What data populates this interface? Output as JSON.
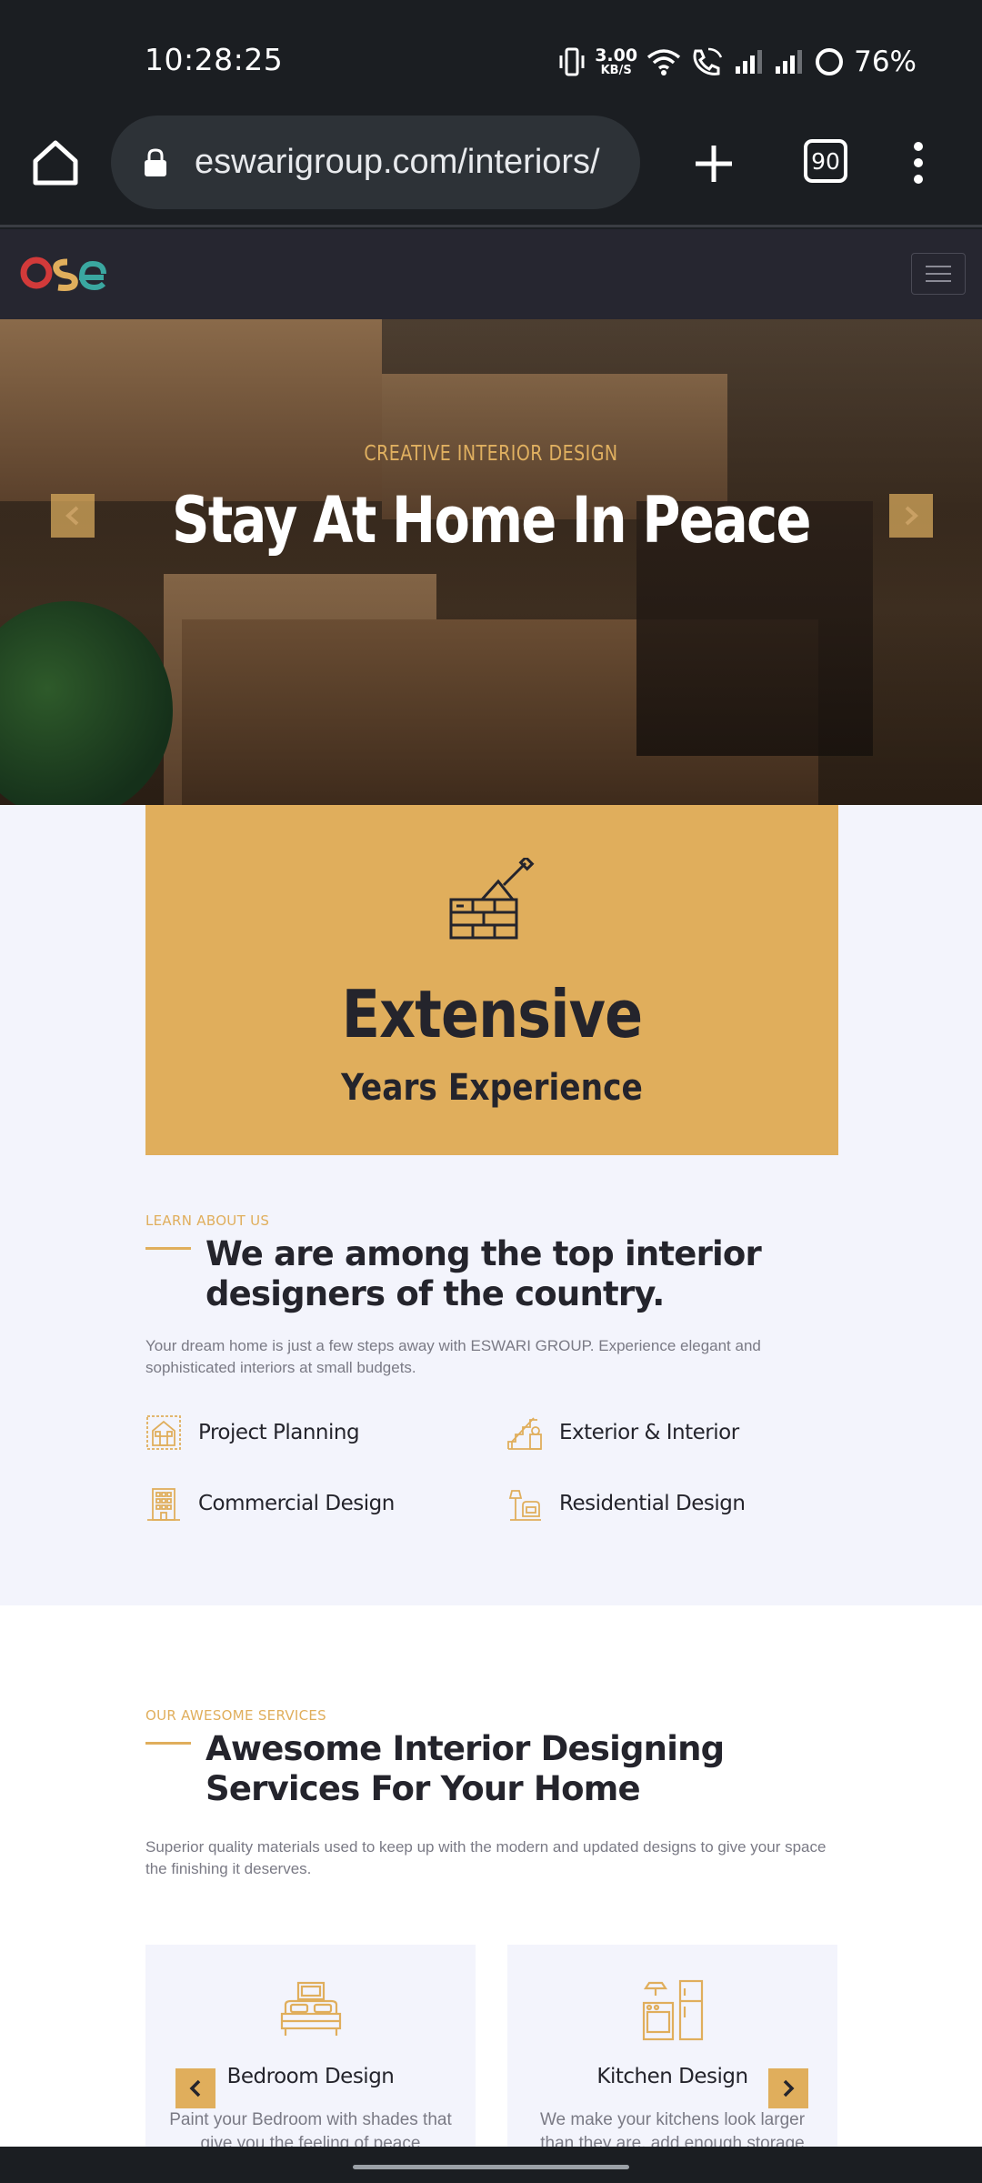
{
  "status_bar": {
    "time": "10:28:25",
    "net_speed_value": "3.00",
    "net_speed_unit": "KB/S",
    "battery_percent": "76%",
    "icons": [
      "vibrate-icon",
      "net-speed",
      "wifi-icon",
      "wifi-call-icon",
      "signal-icon",
      "signal-icon",
      "battery-ring-icon"
    ]
  },
  "browser": {
    "url": "eswarigroup.com/interiors/",
    "tab_count": "90",
    "icons": [
      "home-icon",
      "lock-icon",
      "plus-icon",
      "tabs-icon",
      "more-vert-icon"
    ]
  },
  "site": {
    "logo_text": "ose",
    "hero": {
      "subtitle": "CREATIVE INTERIOR DESIGN",
      "title": "Stay At Home In Peace"
    },
    "experience": {
      "title": "Extensive",
      "subtitle": "Years Experience"
    },
    "about": {
      "kicker": "LEARN ABOUT US",
      "title": "We are among the top interior designers of the country.",
      "text": "Your dream home is just a few steps away with ESWARI GROUP. Experience elegant and sophisticated interiors at small budgets.",
      "features": [
        {
          "label": "Project Planning",
          "icon": "house-plan-icon"
        },
        {
          "label": "Exterior & Interior",
          "icon": "stairs-icon"
        },
        {
          "label": "Commercial Design",
          "icon": "building-icon"
        },
        {
          "label": "Residential Design",
          "icon": "armchair-lamp-icon"
        }
      ]
    },
    "services": {
      "kicker": "OUR AWESOME SERVICES",
      "title": "Awesome Interior Designing Services For Your Home",
      "text": "Superior quality materials used to keep up with the modern and updated designs to give your space the finishing it deserves.",
      "cards": [
        {
          "title": "Bedroom Design",
          "text": "Paint your Bedroom with shades that give you the feeling of peace",
          "icon": "bed-icon"
        },
        {
          "title": "Kitchen Design",
          "text": "We make your kitchens look larger than they are, add enough storage",
          "icon": "kitchen-icon"
        }
      ]
    }
  },
  "colors": {
    "accent": "#e0ae5c",
    "dark": "#24242c",
    "nav_bg": "#262630",
    "section_bg": "#f3f4fc",
    "chrome_bg": "#1b1e22"
  }
}
